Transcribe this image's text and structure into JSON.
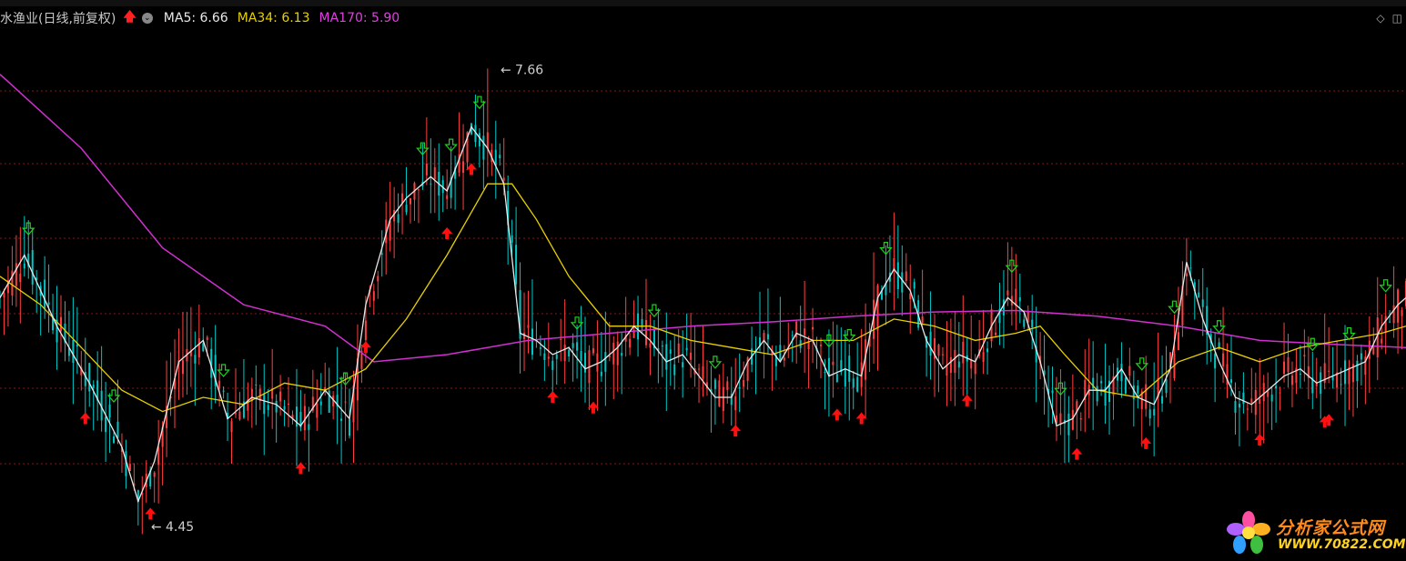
{
  "header": {
    "title": "水渔业(日线,前复权)",
    "ma_items": [
      {
        "label": "MA5: 6.66",
        "color": "#e8e8e8"
      },
      {
        "label": "MA34: 6.13",
        "color": "#e8d000"
      },
      {
        "label": "MA170: 5.90",
        "color": "#e040e0"
      }
    ]
  },
  "colors": {
    "background": "#000000",
    "up_candle": "#ff4040",
    "down_candle": "#00c8c8",
    "grid": "#8a1515",
    "buy_arrow": "#ff1010",
    "sell_arrow": "#20d020",
    "ma5": "#e8e8e8",
    "ma34": "#e8d000",
    "ma170": "#d030d0"
  },
  "logo": {
    "name": "分析家公式网",
    "url": "WWW.70822.COM"
  },
  "chart_data": {
    "type": "candlestick",
    "ylim": [
      4.2,
      7.95
    ],
    "grid": true,
    "annotations": [
      {
        "text": "7.66",
        "x": 120,
        "price": 7.66
      },
      {
        "text": "4.45",
        "x": 34,
        "price": 4.45
      }
    ],
    "ma5_path": [
      [
        0,
        6.05
      ],
      [
        6,
        6.35
      ],
      [
        14,
        5.85
      ],
      [
        22,
        5.45
      ],
      [
        30,
        5.0
      ],
      [
        34,
        4.62
      ],
      [
        38,
        4.9
      ],
      [
        44,
        5.6
      ],
      [
        50,
        5.75
      ],
      [
        56,
        5.2
      ],
      [
        62,
        5.35
      ],
      [
        68,
        5.3
      ],
      [
        74,
        5.15
      ],
      [
        80,
        5.4
      ],
      [
        86,
        5.2
      ],
      [
        90,
        6.0
      ],
      [
        96,
        6.6
      ],
      [
        100,
        6.75
      ],
      [
        106,
        6.9
      ],
      [
        110,
        6.8
      ],
      [
        116,
        7.25
      ],
      [
        120,
        7.1
      ],
      [
        124,
        6.85
      ],
      [
        128,
        5.8
      ],
      [
        132,
        5.75
      ],
      [
        136,
        5.65
      ],
      [
        140,
        5.7
      ],
      [
        144,
        5.55
      ],
      [
        148,
        5.6
      ],
      [
        152,
        5.7
      ],
      [
        156,
        5.85
      ],
      [
        160,
        5.75
      ],
      [
        164,
        5.6
      ],
      [
        168,
        5.65
      ],
      [
        172,
        5.5
      ],
      [
        176,
        5.35
      ],
      [
        180,
        5.35
      ],
      [
        184,
        5.6
      ],
      [
        188,
        5.75
      ],
      [
        192,
        5.6
      ],
      [
        196,
        5.8
      ],
      [
        200,
        5.75
      ],
      [
        204,
        5.5
      ],
      [
        208,
        5.55
      ],
      [
        212,
        5.5
      ],
      [
        216,
        6.05
      ],
      [
        220,
        6.25
      ],
      [
        224,
        6.1
      ],
      [
        228,
        5.75
      ],
      [
        232,
        5.55
      ],
      [
        236,
        5.65
      ],
      [
        240,
        5.6
      ],
      [
        244,
        5.85
      ],
      [
        248,
        6.05
      ],
      [
        252,
        5.95
      ],
      [
        256,
        5.6
      ],
      [
        260,
        5.15
      ],
      [
        264,
        5.2
      ],
      [
        268,
        5.4
      ],
      [
        272,
        5.4
      ],
      [
        276,
        5.55
      ],
      [
        280,
        5.35
      ],
      [
        284,
        5.3
      ],
      [
        288,
        5.55
      ],
      [
        292,
        6.3
      ],
      [
        296,
        5.9
      ],
      [
        300,
        5.6
      ],
      [
        304,
        5.35
      ],
      [
        308,
        5.3
      ],
      [
        312,
        5.4
      ],
      [
        316,
        5.5
      ],
      [
        320,
        5.55
      ],
      [
        324,
        5.45
      ],
      [
        328,
        5.5
      ],
      [
        332,
        5.55
      ],
      [
        336,
        5.6
      ],
      [
        340,
        5.85
      ],
      [
        344,
        6.0
      ],
      [
        346,
        6.05
      ]
    ],
    "ma34_path": [
      [
        0,
        6.2
      ],
      [
        10,
        6.0
      ],
      [
        20,
        5.7
      ],
      [
        30,
        5.4
      ],
      [
        40,
        5.25
      ],
      [
        50,
        5.35
      ],
      [
        60,
        5.3
      ],
      [
        70,
        5.45
      ],
      [
        80,
        5.4
      ],
      [
        90,
        5.55
      ],
      [
        100,
        5.9
      ],
      [
        110,
        6.35
      ],
      [
        120,
        6.85
      ],
      [
        126,
        6.85
      ],
      [
        132,
        6.6
      ],
      [
        140,
        6.2
      ],
      [
        150,
        5.85
      ],
      [
        160,
        5.85
      ],
      [
        170,
        5.75
      ],
      [
        180,
        5.7
      ],
      [
        190,
        5.65
      ],
      [
        200,
        5.75
      ],
      [
        210,
        5.75
      ],
      [
        220,
        5.9
      ],
      [
        230,
        5.85
      ],
      [
        240,
        5.75
      ],
      [
        250,
        5.8
      ],
      [
        256,
        5.85
      ],
      [
        262,
        5.65
      ],
      [
        270,
        5.4
      ],
      [
        280,
        5.35
      ],
      [
        290,
        5.6
      ],
      [
        300,
        5.7
      ],
      [
        310,
        5.6
      ],
      [
        320,
        5.7
      ],
      [
        330,
        5.75
      ],
      [
        340,
        5.8
      ],
      [
        346,
        5.85
      ]
    ],
    "ma170_path": [
      [
        0,
        7.62
      ],
      [
        20,
        7.1
      ],
      [
        40,
        6.4
      ],
      [
        60,
        6.0
      ],
      [
        80,
        5.85
      ],
      [
        92,
        5.6
      ],
      [
        110,
        5.65
      ],
      [
        130,
        5.75
      ],
      [
        150,
        5.8
      ],
      [
        170,
        5.85
      ],
      [
        190,
        5.88
      ],
      [
        210,
        5.92
      ],
      [
        230,
        5.95
      ],
      [
        250,
        5.96
      ],
      [
        270,
        5.92
      ],
      [
        290,
        5.85
      ],
      [
        310,
        5.75
      ],
      [
        330,
        5.72
      ],
      [
        346,
        5.7
      ]
    ],
    "buy_signals": [
      21,
      37,
      74,
      90,
      110,
      116,
      136,
      146,
      181,
      206,
      212,
      238,
      265,
      282,
      310,
      326,
      327
    ],
    "sell_signals": [
      7,
      28,
      55,
      85,
      104,
      111,
      118,
      142,
      161,
      176,
      204,
      209,
      218,
      249,
      261,
      281,
      289,
      300,
      323,
      332,
      341
    ]
  }
}
